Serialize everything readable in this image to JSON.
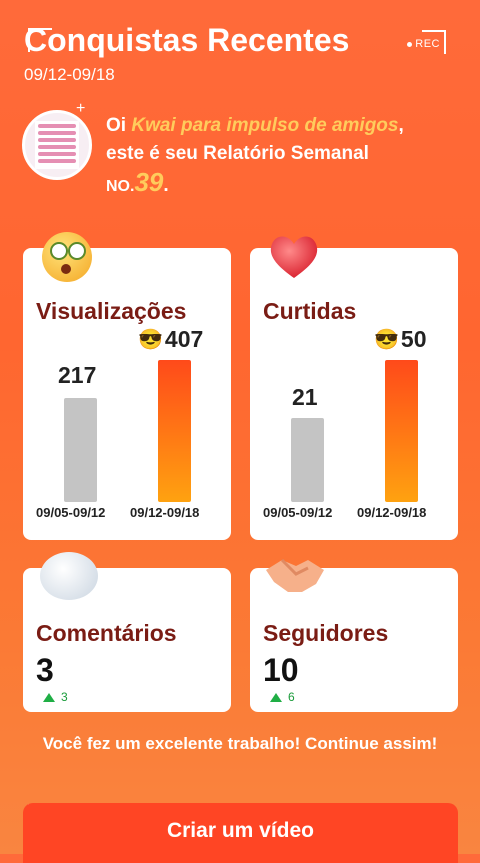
{
  "header": {
    "title": "Conquistas Recentes",
    "date_range": "09/12-09/18",
    "rec_label": "REC"
  },
  "greeting": {
    "prefix": "Oi ",
    "account_name": "Kwai para impulso de amigos",
    "comma": ",",
    "line2": "este é seu Relatório Semanal",
    "no_label": "NO.",
    "report_number": "39",
    "period": "."
  },
  "cards": {
    "views": {
      "title": "Visualizações",
      "previous_value": "217",
      "current_value": "407",
      "previous_label": "09/05-09/12",
      "current_label": "09/12-09/18"
    },
    "likes": {
      "title": "Curtidas",
      "previous_value": "21",
      "current_value": "50",
      "previous_label": "09/05-09/12",
      "current_label": "09/12-09/18"
    },
    "comments": {
      "title": "Comentários",
      "value": "3",
      "delta": "3"
    },
    "followers": {
      "title": "Seguidores",
      "value": "10",
      "delta": "6"
    }
  },
  "footer": {
    "message": "Você fez um excelente trabalho! Continue assim!",
    "cta_label": "Criar um vídeo"
  },
  "icons": {
    "views": "surprised-face-icon",
    "likes": "heart-icon",
    "comments": "speech-bubble-icon",
    "followers": "handshake-icon",
    "value_badge": "sunglasses-face-icon"
  },
  "colors": {
    "accent": "#ff4524",
    "highlight": "#ffcc5c",
    "increase": "#1fae45"
  }
}
